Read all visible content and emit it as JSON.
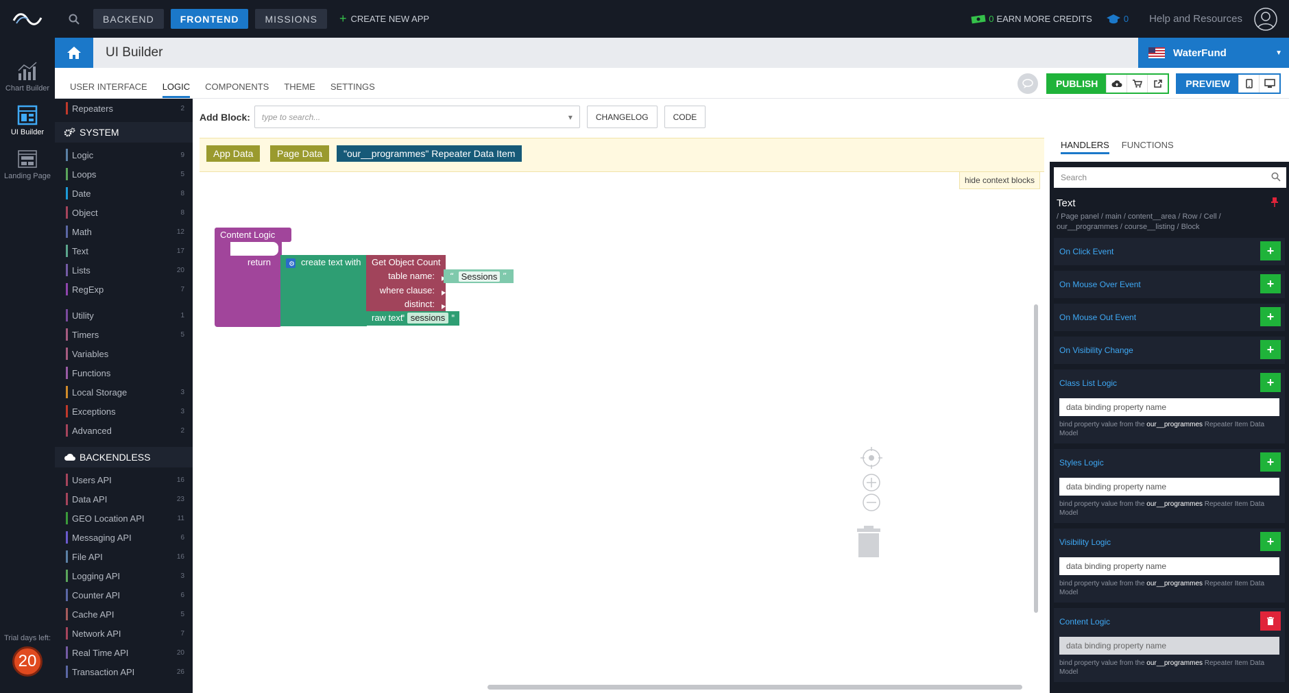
{
  "topbar": {
    "tabs": [
      "BACKEND",
      "FRONTEND",
      "MISSIONS"
    ],
    "active_tab": "FRONTEND",
    "create_app": "CREATE NEW APP",
    "credits_count": "0",
    "credits_label": "EARN MORE CREDITS",
    "missions_count": "0",
    "help": "Help and Resources"
  },
  "rail": {
    "items": [
      "Chart Builder",
      "UI Builder",
      "Landing Page"
    ],
    "active": "UI Builder",
    "trial_label": "Trial days left:",
    "trial_days": "20"
  },
  "titlebar": {
    "title": "UI Builder",
    "app_name": "WaterFund"
  },
  "subtabs": {
    "items": [
      "USER INTERFACE",
      "LOGIC",
      "COMPONENTS",
      "THEME",
      "SETTINGS"
    ],
    "active": "LOGIC",
    "publish": "PUBLISH",
    "preview": "PREVIEW"
  },
  "categories": {
    "top": [
      {
        "label": "Repeaters",
        "count": "2",
        "color": "#c0392b"
      }
    ],
    "system_header": "SYSTEM",
    "system_group1": [
      {
        "label": "Logic",
        "count": "9",
        "color": "#5b80a5"
      },
      {
        "label": "Loops",
        "count": "5",
        "color": "#5ba55b"
      },
      {
        "label": "Date",
        "count": "8",
        "color": "#1d9bd8"
      },
      {
        "label": "Object",
        "count": "8",
        "color": "#a5445b"
      },
      {
        "label": "Math",
        "count": "12",
        "color": "#5b67a5"
      },
      {
        "label": "Text",
        "count": "17",
        "color": "#5ba58c"
      },
      {
        "label": "Lists",
        "count": "20",
        "color": "#745ba5"
      },
      {
        "label": "RegExp",
        "count": "7",
        "color": "#8e44ad"
      }
    ],
    "system_group2": [
      {
        "label": "Utility",
        "count": "1",
        "color": "#7a4a9e"
      },
      {
        "label": "Timers",
        "count": "5",
        "color": "#a55b80"
      },
      {
        "label": "Variables",
        "count": "",
        "color": "#a55b80"
      },
      {
        "label": "Functions",
        "count": "",
        "color": "#995ba5"
      },
      {
        "label": "Local Storage",
        "count": "3",
        "color": "#d08c2a"
      },
      {
        "label": "Exceptions",
        "count": "3",
        "color": "#c0392b"
      },
      {
        "label": "Advanced",
        "count": "2",
        "color": "#a5445b"
      }
    ],
    "backendless_header": "BACKENDLESS",
    "backendless": [
      {
        "label": "Users API",
        "count": "16",
        "color": "#a5445b"
      },
      {
        "label": "Data API",
        "count": "23",
        "color": "#a5445b"
      },
      {
        "label": "GEO Location API",
        "count": "11",
        "color": "#3a9a3a"
      },
      {
        "label": "Messaging API",
        "count": "6",
        "color": "#6a5acd"
      },
      {
        "label": "File API",
        "count": "16",
        "color": "#5b80a5"
      },
      {
        "label": "Logging API",
        "count": "3",
        "color": "#5ba55b"
      },
      {
        "label": "Counter API",
        "count": "6",
        "color": "#5b67a5"
      },
      {
        "label": "Cache API",
        "count": "5",
        "color": "#a55b5b"
      },
      {
        "label": "Network API",
        "count": "7",
        "color": "#a5445b"
      },
      {
        "label": "Real Time API",
        "count": "20",
        "color": "#745ba5"
      },
      {
        "label": "Transaction API",
        "count": "26",
        "color": "#5b67a5"
      }
    ]
  },
  "workspace": {
    "add_block_label": "Add Block:",
    "add_block_placeholder": "type to search...",
    "changelog": "CHANGELOG",
    "code": "CODE",
    "context_blocks": [
      "App Data",
      "Page Data",
      "\"our__programmes\" Repeater Data Item"
    ],
    "hide_context": "hide context blocks",
    "blocks": {
      "content_logic": "Content Logic",
      "return": "return",
      "create_text": "create text with",
      "get_count": "Get Object Count",
      "table_name": "table name:",
      "where_clause": "where clause:",
      "distinct": "distinct:",
      "sessions_str": "Sessions",
      "raw_text": "raw text",
      "raw_value": "sessions"
    }
  },
  "panel": {
    "tabs": [
      "HANDLERS",
      "FUNCTIONS"
    ],
    "active": "HANDLERS",
    "search_placeholder": "Search",
    "title": "Text",
    "path": "/ Page panel / main / content__area / Row / Cell / our__programmes / course__listing / Block",
    "events": [
      "On Click Event",
      "On Mouse Over Event",
      "On Mouse Out Event",
      "On Visibility Change"
    ],
    "logic": [
      "Class List Logic",
      "Styles Logic",
      "Visibility Logic",
      "Content Logic"
    ],
    "binding_placeholder": "data binding property name",
    "hint_pre": "bind property value from the",
    "hint_bold": "our__programmes",
    "hint_post": "Repeater Item Data Model"
  },
  "colors": {
    "accent": "#1b78c9",
    "success": "#1fb33a",
    "danger": "#e0243a",
    "dark": "#161b25"
  }
}
